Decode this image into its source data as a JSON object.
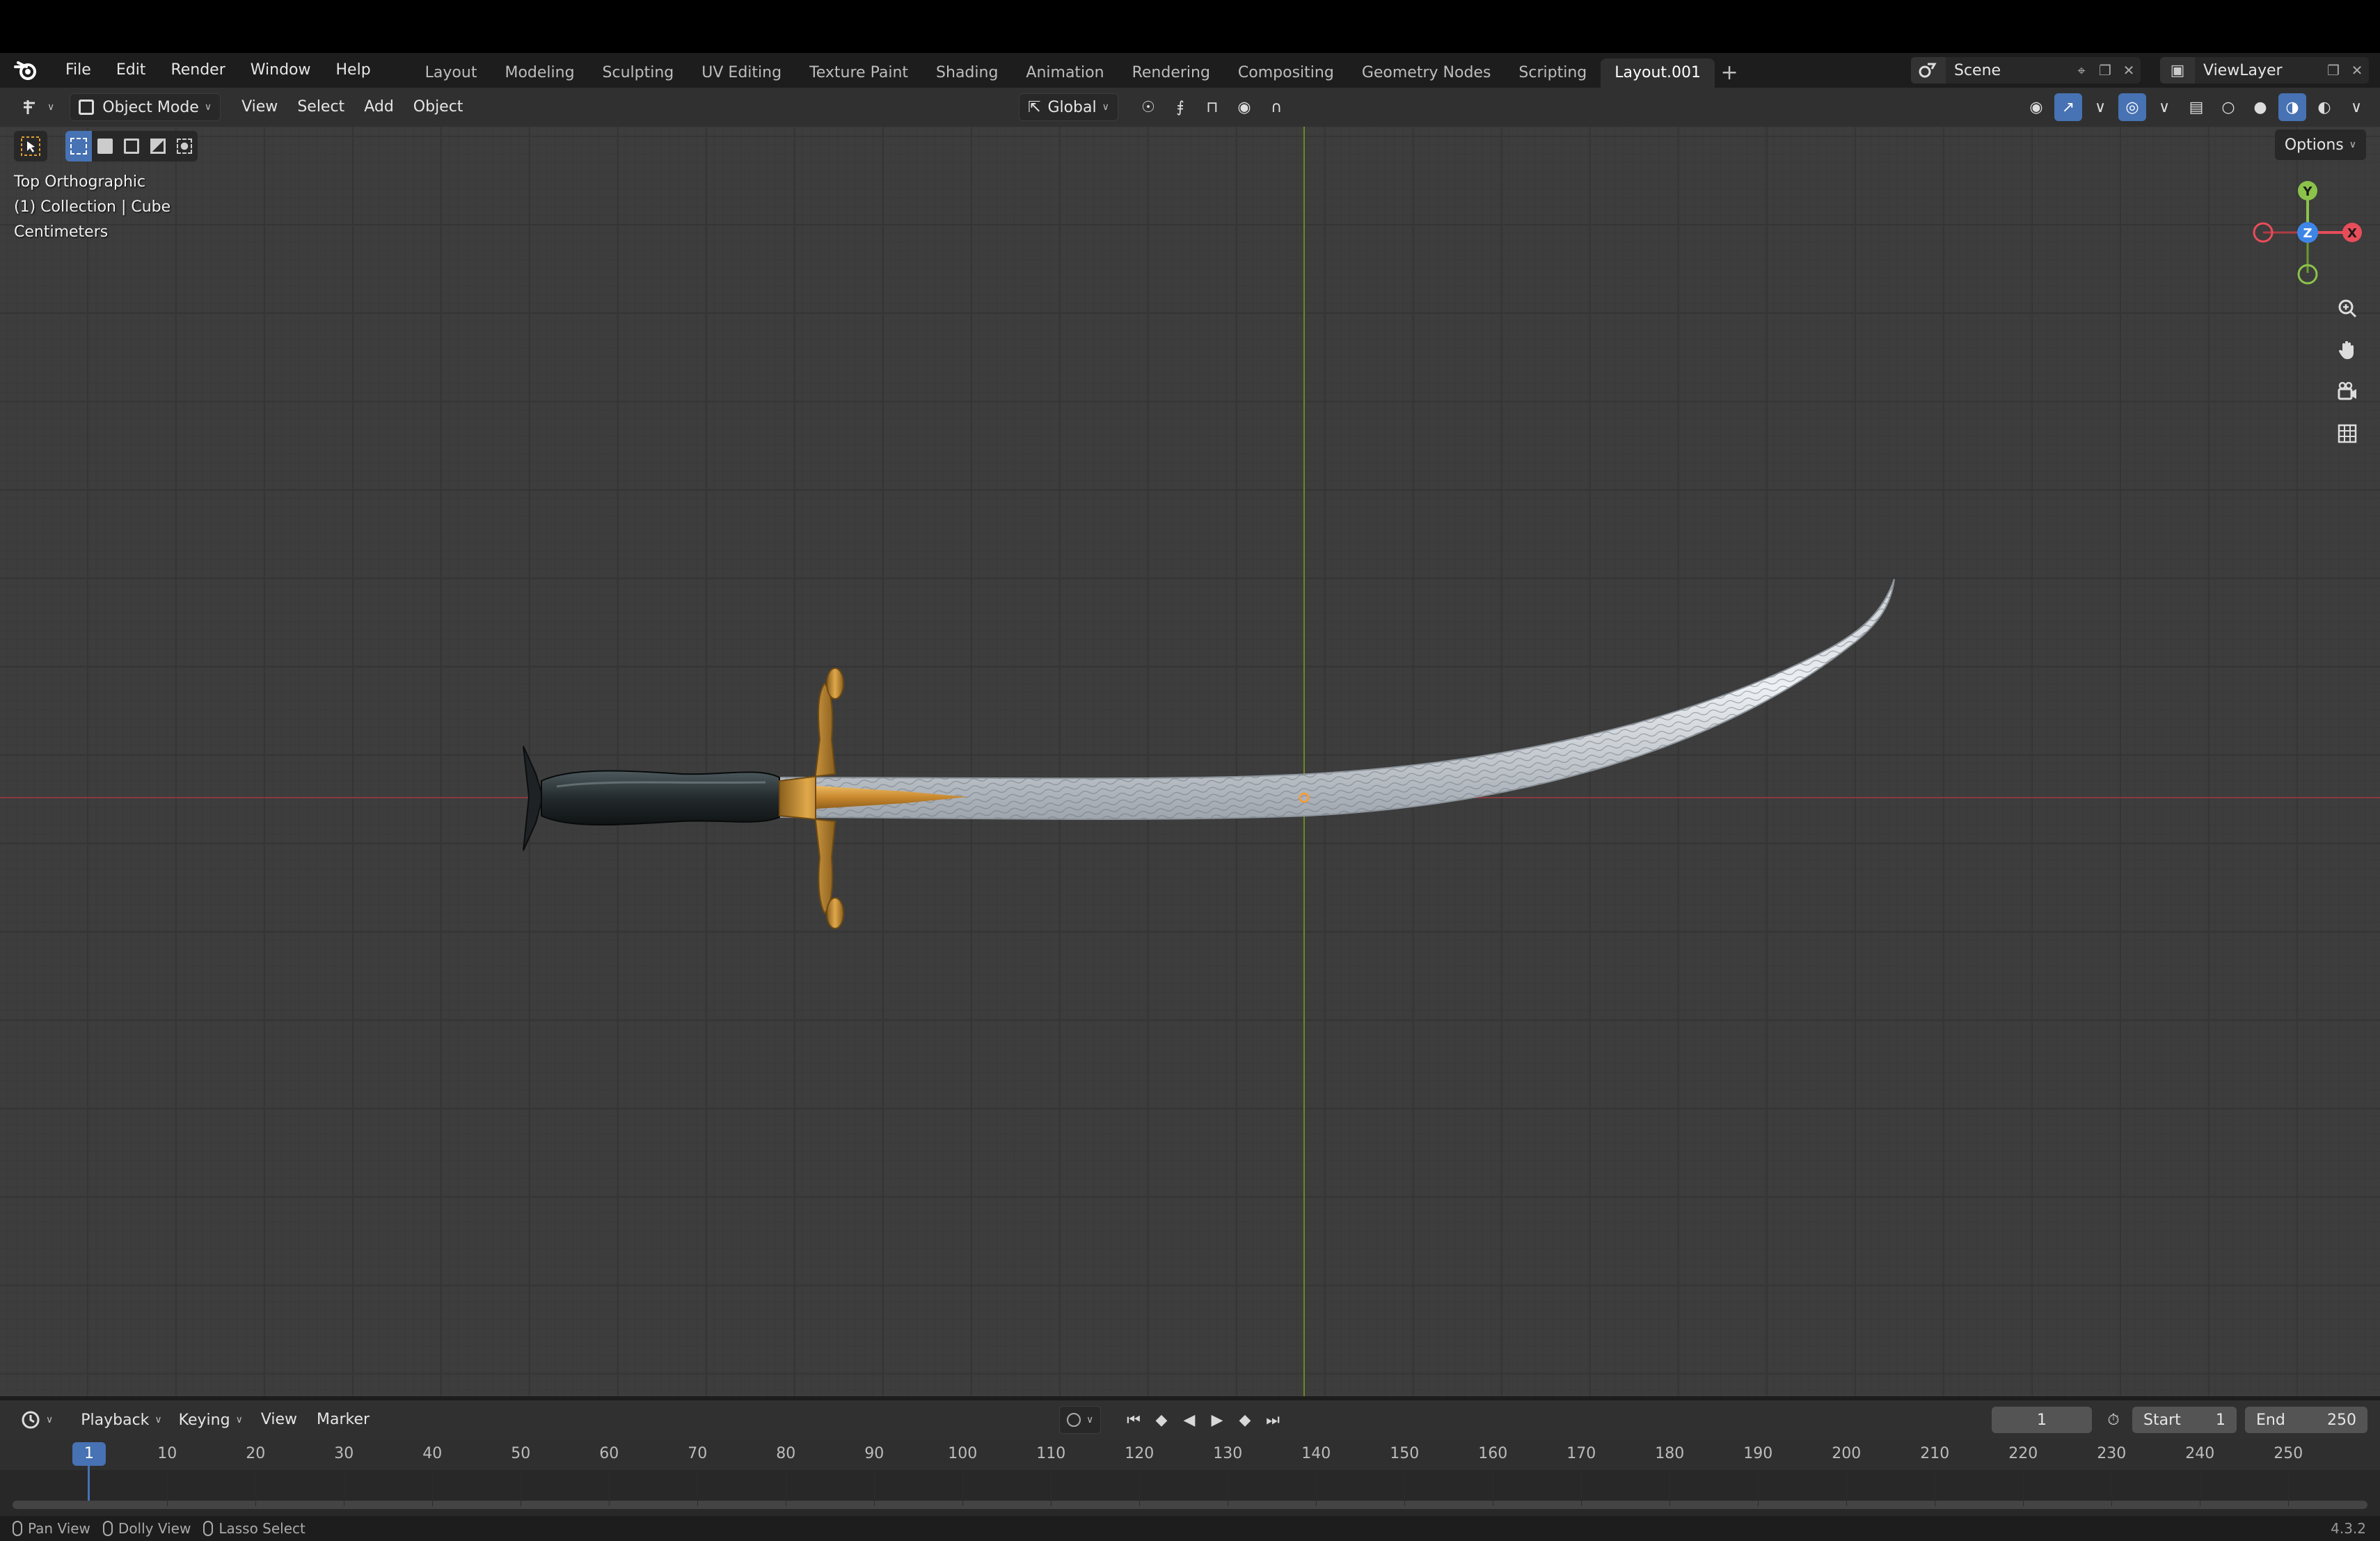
{
  "menu": [
    "File",
    "Edit",
    "Render",
    "Window",
    "Help"
  ],
  "workspaces": [
    "Layout",
    "Modeling",
    "Sculpting",
    "UV Editing",
    "Texture Paint",
    "Shading",
    "Animation",
    "Rendering",
    "Compositing",
    "Geometry Nodes",
    "Scripting",
    "Layout.001"
  ],
  "active_workspace": "Layout.001",
  "scene": {
    "name": "Scene",
    "view_layer": "ViewLayer"
  },
  "viewport_header": {
    "mode": "Object Mode",
    "menus": [
      "View",
      "Select",
      "Add",
      "Object"
    ],
    "transform_orientation": "Global"
  },
  "viewport": {
    "overlay_lines": [
      "Top Orthographic",
      "(1) Collection | Cube",
      "Centimeters"
    ],
    "options_label": "Options",
    "gizmo": {
      "y": "Y",
      "z": "Z",
      "x": "X"
    }
  },
  "timeline": {
    "menus": [
      "Playback",
      "Keying",
      "View",
      "Marker"
    ],
    "current_frame": "1",
    "start_label": "Start",
    "start": "1",
    "end_label": "End",
    "end": "250",
    "ruler": [
      "10",
      "20",
      "30",
      "40",
      "50",
      "60",
      "70",
      "80",
      "90",
      "100",
      "110",
      "120",
      "130",
      "140",
      "150",
      "160",
      "170",
      "180",
      "190",
      "200",
      "210",
      "220",
      "230",
      "240",
      "250"
    ],
    "ruler_current": "1"
  },
  "status": {
    "items": [
      "Pan View",
      "Dolly View",
      "Lasso Select"
    ],
    "version": "4.3.2"
  },
  "colors": {
    "accent": "#4772b3",
    "x_axis": "#e84d5a",
    "y_axis": "#8bc34a",
    "z_axis": "#3d86e8"
  }
}
